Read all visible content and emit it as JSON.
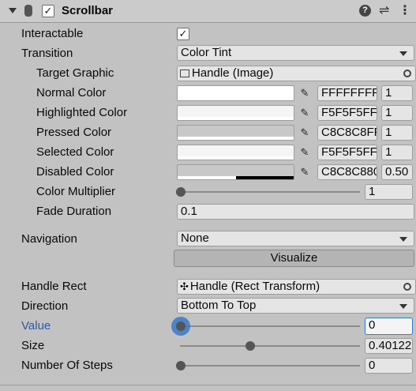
{
  "component": {
    "title": "Scrollbar",
    "enabled_check": "✓",
    "help_icon": "?",
    "preset_icon": "⇌",
    "menu_icon": "⋮"
  },
  "fields": {
    "interactable": {
      "label": "Interactable",
      "check": "✓"
    },
    "transition": {
      "label": "Transition",
      "value": "Color Tint"
    },
    "target_graphic": {
      "label": "Target Graphic",
      "value": "Handle (Image)"
    },
    "normal_color": {
      "label": "Normal Color",
      "hex": "FFFFFFFF",
      "mult": "1",
      "swatch": "#ffffff"
    },
    "highlighted_color": {
      "label": "Highlighted Color",
      "hex": "F5F5F5FF",
      "mult": "1",
      "swatch": "#f5f5f5"
    },
    "pressed_color": {
      "label": "Pressed Color",
      "hex": "C8C8C8FF",
      "mult": "1",
      "swatch": "#c8c8c8"
    },
    "selected_color": {
      "label": "Selected Color",
      "hex": "F5F5F5FF",
      "mult": "1",
      "swatch": "#f5f5f5"
    },
    "disabled_color": {
      "label": "Disabled Color",
      "hex": "C8C8C880",
      "mult": "0.50",
      "swatch": "#c8c8c8"
    },
    "color_multiplier": {
      "label": "Color Multiplier",
      "value": "1",
      "level": 0.0
    },
    "fade_duration": {
      "label": "Fade Duration",
      "value": "0.1"
    },
    "navigation": {
      "label": "Navigation",
      "value": "None"
    },
    "visualize": {
      "label": "Visualize"
    },
    "handle_rect": {
      "label": "Handle Rect",
      "value": "Handle (Rect Transform)"
    },
    "direction": {
      "label": "Direction",
      "value": "Bottom To Top"
    },
    "value": {
      "label": "Value",
      "value": "0",
      "level": 0.0
    },
    "size": {
      "label": "Size",
      "value": "0.40122",
      "level": 0.4
    },
    "number_of_steps": {
      "label": "Number Of Steps",
      "value": "0",
      "level": 0.0
    }
  },
  "colors": {
    "background": "#c2c2c2",
    "accent_label": "#2c5a9c",
    "focus_ring": "#3a79c8"
  }
}
